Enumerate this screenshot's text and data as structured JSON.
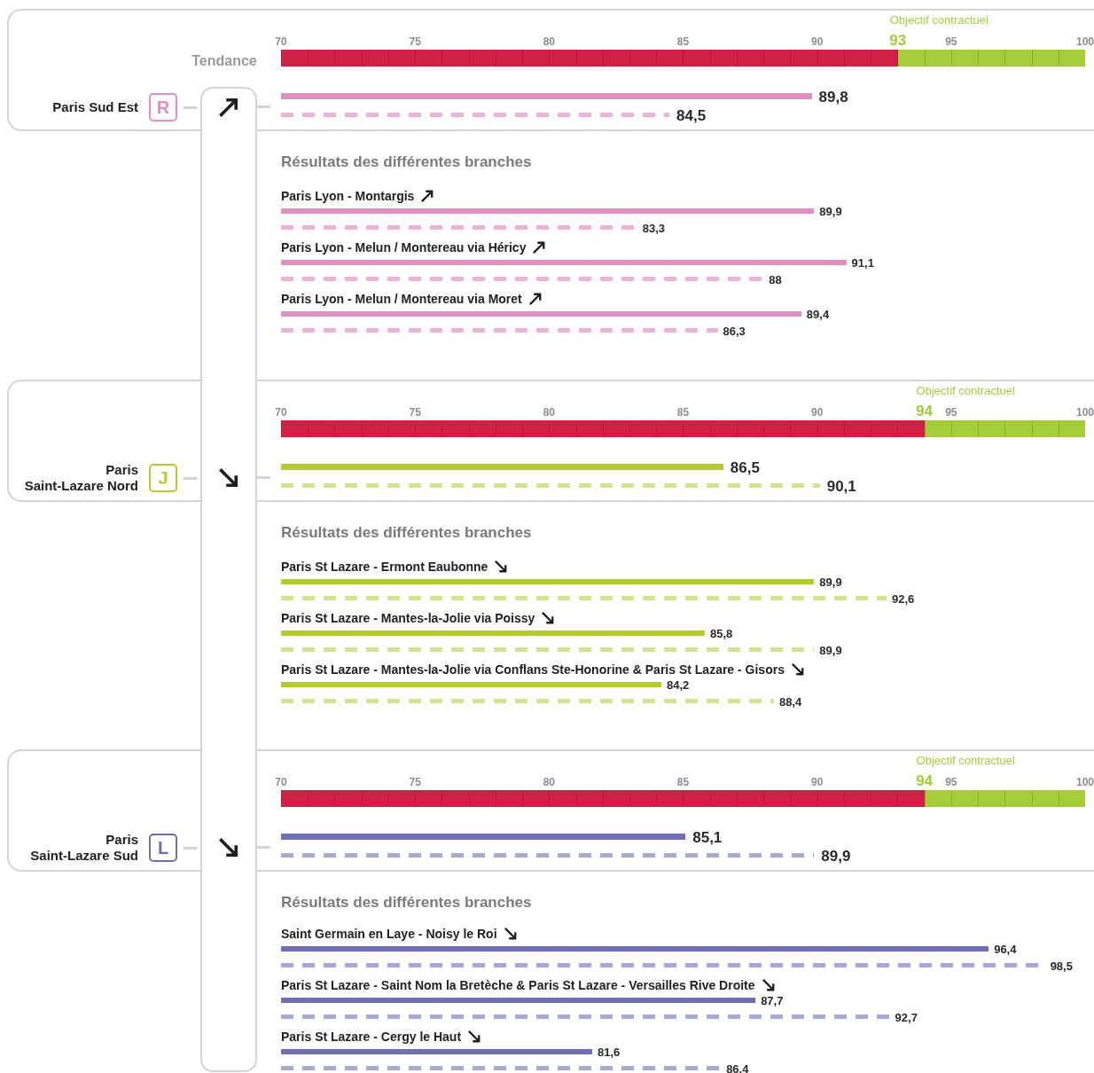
{
  "trend_header": "Tendance",
  "sections": [
    {
      "label": "Paris Sud Est",
      "letter": "R",
      "color": "#e08fc0",
      "kind": "rising",
      "scale": {
        "ticks": [
          "70",
          "75",
          "80",
          "85",
          "90",
          "95",
          "100"
        ],
        "objective": {
          "label": "Objectif contractuel",
          "value": "93",
          "level": 0.767
        }
      },
      "bars": [
        {
          "kind": "solid",
          "color": "#e08fc0",
          "level": 0.66,
          "reading": "89,8"
        },
        {
          "kind": "dashed",
          "color": "#ebb3d5",
          "level": 0.483,
          "reading": "84,5"
        }
      ],
      "branches_title": "Résultats des différentes branches",
      "branches": [
        {
          "name": "Paris Lyon - Montargis",
          "kind": "rising",
          "bars": [
            {
              "kind": "solid",
              "color": "#e08fc0",
              "level": 0.663,
              "reading": "89,9"
            },
            {
              "kind": "dashed",
              "color": "#ebb3d5",
              "level": 0.443,
              "reading": "83,3"
            }
          ]
        },
        {
          "name": "Paris Lyon - Melun / Montereau via Héricy",
          "kind": "rising",
          "bars": [
            {
              "kind": "solid",
              "color": "#e08fc0",
              "level": 0.703,
              "reading": "91,1"
            },
            {
              "kind": "dashed",
              "color": "#ebb3d5",
              "level": 0.6,
              "reading": "88"
            }
          ]
        },
        {
          "name": "Paris Lyon - Melun / Montereau via Moret",
          "kind": "rising",
          "bars": [
            {
              "kind": "solid",
              "color": "#e08fc0",
              "level": 0.647,
              "reading": "89,4"
            },
            {
              "kind": "dashed",
              "color": "#ebb3d5",
              "level": 0.543,
              "reading": "86,3"
            }
          ]
        }
      ]
    },
    {
      "label": "Paris\nSaint-Lazare Nord",
      "letter": "J",
      "color": "#b5cc2a",
      "kind": "falling",
      "scale": {
        "ticks": [
          "70",
          "75",
          "80",
          "85",
          "90",
          "95",
          "100"
        ],
        "objective": {
          "label": "Objectif contractuel",
          "value": "94",
          "level": 0.8
        }
      },
      "bars": [
        {
          "kind": "solid",
          "color": "#b5cc2a",
          "level": 0.55,
          "reading": "86,5"
        },
        {
          "kind": "dashed",
          "color": "#d6e28e",
          "level": 0.67,
          "reading": "90,1"
        }
      ],
      "branches_title": "Résultats des différentes branches",
      "branches": [
        {
          "name": "Paris St Lazare - Ermont Eaubonne",
          "kind": "falling",
          "bars": [
            {
              "kind": "solid",
              "color": "#b5cc2a",
              "level": 0.663,
              "reading": "89,9"
            },
            {
              "kind": "dashed",
              "color": "#d6e28e",
              "level": 0.753,
              "reading": "92,6"
            }
          ]
        },
        {
          "name": "Paris St Lazare - Mantes-la-Jolie via Poissy",
          "kind": "falling",
          "bars": [
            {
              "kind": "solid",
              "color": "#b5cc2a",
              "level": 0.527,
              "reading": "85,8"
            },
            {
              "kind": "dashed",
              "color": "#d6e28e",
              "level": 0.663,
              "reading": "89,9"
            }
          ]
        },
        {
          "name": "Paris St Lazare - Mantes-la-Jolie via Conflans Ste-Honorine & Paris St Lazare - Gisors",
          "kind": "falling",
          "bars": [
            {
              "kind": "solid",
              "color": "#b5cc2a",
              "level": 0.473,
              "reading": "84,2"
            },
            {
              "kind": "dashed",
              "color": "#d6e28e",
              "level": 0.613,
              "reading": "88,4"
            }
          ]
        }
      ]
    },
    {
      "label": "Paris\nSaint-Lazare Sud",
      "letter": "L",
      "color": "#6f6db5",
      "kind": "falling",
      "scale": {
        "ticks": [
          "70",
          "75",
          "80",
          "85",
          "90",
          "95",
          "100"
        ],
        "objective": {
          "label": "Objectif contractuel",
          "value": "94",
          "level": 0.8
        }
      },
      "bars": [
        {
          "kind": "solid",
          "color": "#6f6db5",
          "level": 0.503,
          "reading": "85,1"
        },
        {
          "kind": "dashed",
          "color": "#a9a7d6",
          "level": 0.663,
          "reading": "89,9"
        }
      ],
      "branches_title": "Résultats des différentes branches",
      "branches": [
        {
          "name": "Saint Germain en Laye - Noisy le Roi",
          "kind": "falling",
          "bars": [
            {
              "kind": "solid",
              "color": "#6f6db5",
              "level": 0.88,
              "reading": "96,4"
            },
            {
              "kind": "dashed",
              "color": "#a9a7d6",
              "level": 0.95,
              "reading": "98,5"
            }
          ]
        },
        {
          "name": "Paris St Lazare - Saint Nom la Bretèche & Paris St Lazare - Versailles Rive Droite",
          "kind": "falling",
          "bars": [
            {
              "kind": "solid",
              "color": "#6f6db5",
              "level": 0.59,
              "reading": "87,7"
            },
            {
              "kind": "dashed",
              "color": "#a9a7d6",
              "level": 0.757,
              "reading": "92,7"
            }
          ]
        },
        {
          "name": "Paris St Lazare - Cergy le Haut",
          "kind": "falling",
          "bars": [
            {
              "kind": "solid",
              "color": "#6f6db5",
              "level": 0.387,
              "reading": "81,6"
            },
            {
              "kind": "dashed",
              "color": "#a9a7d6",
              "level": 0.547,
              "reading": "86,4"
            }
          ]
        }
      ]
    }
  ]
}
